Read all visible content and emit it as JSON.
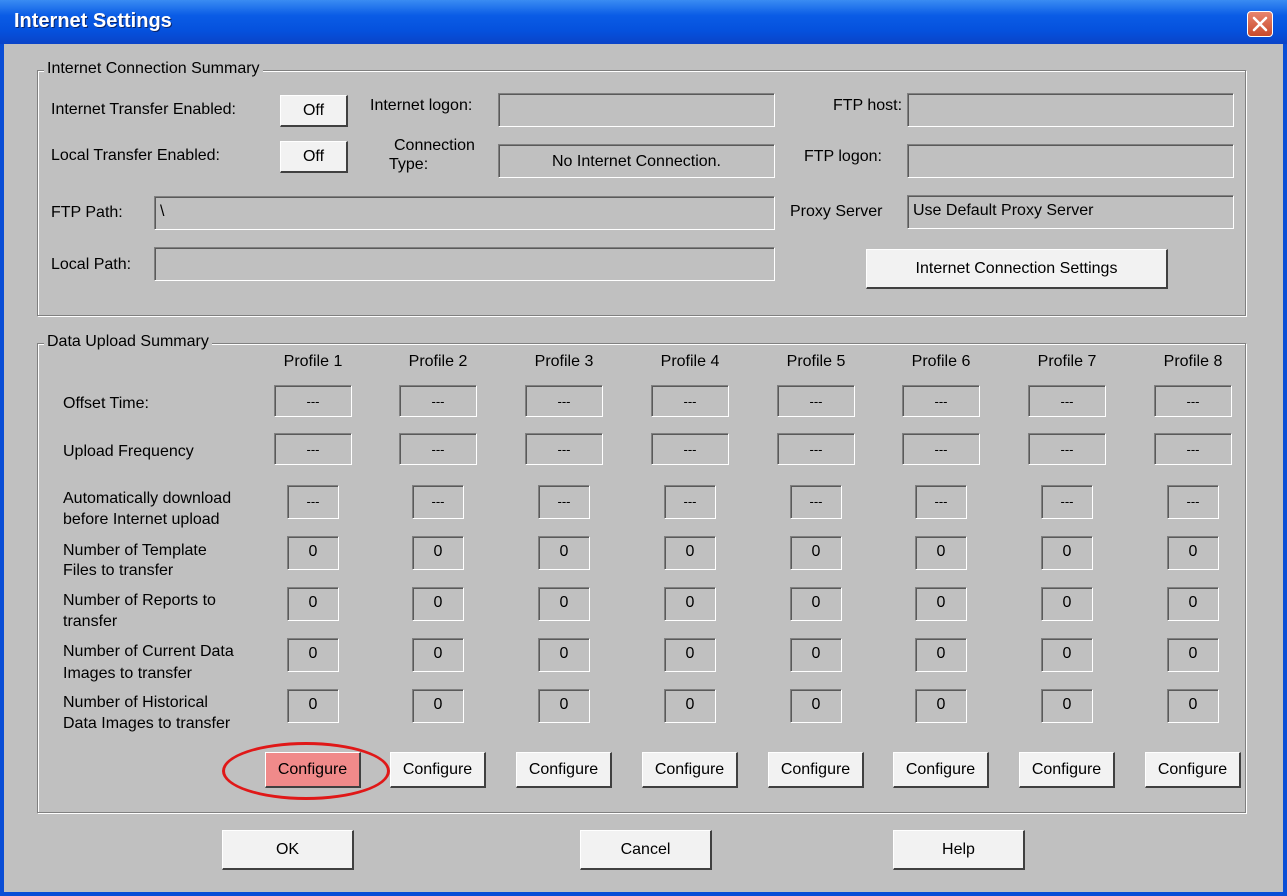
{
  "window": {
    "title": "Internet Settings"
  },
  "icons": {
    "close": "close-icon"
  },
  "colors": {
    "titlebar": "#0551dd",
    "dialog": "#c0c0c0",
    "highlight_ring": "#e01818",
    "highlight_fill": "#f08a8a"
  },
  "connection": {
    "legend": "Internet Connection Summary",
    "internet_transfer_label": "Internet Transfer Enabled:",
    "internet_transfer_value": "Off",
    "local_transfer_label": "Local Transfer Enabled:",
    "local_transfer_value": "Off",
    "internet_logon_label": "Internet logon:",
    "internet_logon_value": "",
    "connection_type_label_1": "Connection",
    "connection_type_label_2": "Type:",
    "connection_type_value": "No Internet Connection.",
    "ftp_host_label": "FTP host:",
    "ftp_host_value": "",
    "ftp_logon_label": "FTP logon:",
    "ftp_logon_value": "",
    "ftp_path_label": "FTP Path:",
    "ftp_path_value": "\\",
    "proxy_label": "Proxy Server",
    "proxy_value": "Use Default Proxy Server",
    "local_path_label": "Local Path:",
    "local_path_value": "",
    "settings_button": "Internet Connection Settings"
  },
  "upload": {
    "legend": "Data Upload Summary",
    "profiles": [
      "Profile 1",
      "Profile 2",
      "Profile 3",
      "Profile 4",
      "Profile 5",
      "Profile 6",
      "Profile 7",
      "Profile 8"
    ],
    "row_labels": {
      "offset": "Offset Time:",
      "frequency": "Upload Frequency",
      "auto_download_1": "Automatically download",
      "auto_download_2": "before Internet upload",
      "templates_1": "Number of Template",
      "templates_2": "Files to transfer",
      "reports_1": "Number of Reports to",
      "reports_2": "transfer",
      "current_1": "Number of Current Data",
      "current_2": "Images to transfer",
      "historical_1": "Number of Historical",
      "historical_2": "Data Images to transfer"
    },
    "offset_values": [
      "---",
      "---",
      "---",
      "---",
      "---",
      "---",
      "---",
      "---"
    ],
    "frequency_values": [
      "---",
      "---",
      "---",
      "---",
      "---",
      "---",
      "---",
      "---"
    ],
    "auto_download_values": [
      "---",
      "---",
      "---",
      "---",
      "---",
      "---",
      "---",
      "---"
    ],
    "template_values": [
      "0",
      "0",
      "0",
      "0",
      "0",
      "0",
      "0",
      "0"
    ],
    "report_values": [
      "0",
      "0",
      "0",
      "0",
      "0",
      "0",
      "0",
      "0"
    ],
    "current_values": [
      "0",
      "0",
      "0",
      "0",
      "0",
      "0",
      "0",
      "0"
    ],
    "historical_values": [
      "0",
      "0",
      "0",
      "0",
      "0",
      "0",
      "0",
      "0"
    ],
    "configure_label": "Configure"
  },
  "buttons": {
    "ok": "OK",
    "cancel": "Cancel",
    "help": "Help"
  }
}
